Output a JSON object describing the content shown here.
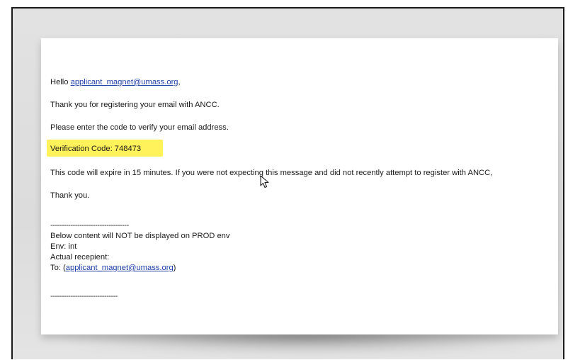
{
  "email": {
    "greeting_prefix": "Hello ",
    "greeting_email": "applicant_magnet@umass.org",
    "greeting_suffix": ",",
    "thanks_registering": "Thank you for registering your email with ANCC.",
    "enter_code": "Please enter the code to verify your email address.",
    "verification_code": "Verification Code: 748473",
    "expire_notice": "This code will expire in 15 minutes. If you were not expecting this message and did not recently attempt to register with ANCC,",
    "thank_you": "Thank you.",
    "divider_1": "-----------------------------------",
    "not_displayed": "Below content will NOT be displayed on PROD env",
    "env": "Env: int",
    "actual_recipient": "Actual recepient:",
    "to_prefix": "To: (",
    "to_email": "applicant_magnet@umass.org",
    "to_suffix": ")",
    "divider_2": "------------------------------"
  },
  "colors": {
    "link": "#1f3fa8",
    "highlight": "#fff25a",
    "frame_border": "#1a1a1a"
  },
  "icons": {
    "cursor": "mouse-pointer-icon"
  }
}
